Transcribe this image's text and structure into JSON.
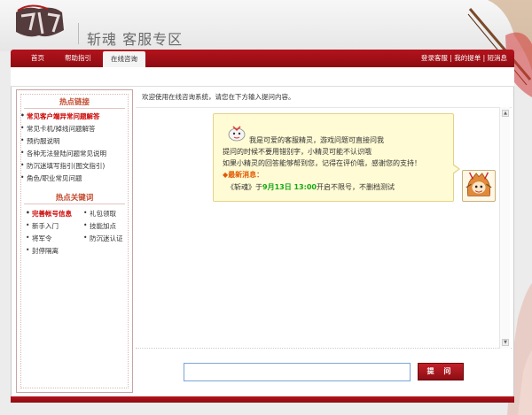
{
  "header": {
    "site_title": "斩魂 客服专区"
  },
  "nav": {
    "tabs": [
      {
        "label": "首页"
      },
      {
        "label": "帮助指引"
      },
      {
        "label": "在线咨询"
      }
    ],
    "right_links": [
      "登录客服",
      "我的提单",
      "短消息"
    ],
    "separator": " | "
  },
  "sidebar": {
    "hot_links_title": "热点链接",
    "hot_links": [
      "常见客户端异常问题解答",
      "常见卡机/掉线问题解答",
      "预约服说明",
      "各种无法登陆问题常见说明",
      "防沉迷填写指引(图文指引)",
      "角色/职业常见问题"
    ],
    "keywords_title": "热点关键词",
    "keywords": [
      [
        "完善帐号信息",
        "礼包领取"
      ],
      [
        "新手入门",
        "技能加点"
      ],
      [
        "将军令",
        "防沉迷认证"
      ],
      [
        "封停隔离"
      ]
    ]
  },
  "chat": {
    "welcome": "欢迎使用在线咨询系统，请您在下方输入提问内容。",
    "bubble_lines": [
      "我是可爱的客服精灵，游戏问题可直接问我",
      "提问的时候不要用错别字，小精灵可能不认识哦",
      "如果小精灵的回答能够帮到您，记得在评价哦，感谢您的支持！"
    ],
    "news_label": "◆最新消息：",
    "news_prefix": "《斩魂》于",
    "news_date": "9月13日  13:00",
    "news_suffix": "开启不限号，不删档测试"
  },
  "input": {
    "placeholder": "",
    "value": ""
  },
  "ask_button": "提 问",
  "colors": {
    "brand_red": "#a5111a",
    "news_orange": "#e05a00",
    "news_green": "#14a814",
    "bubble_bg": "#fffbd4"
  }
}
